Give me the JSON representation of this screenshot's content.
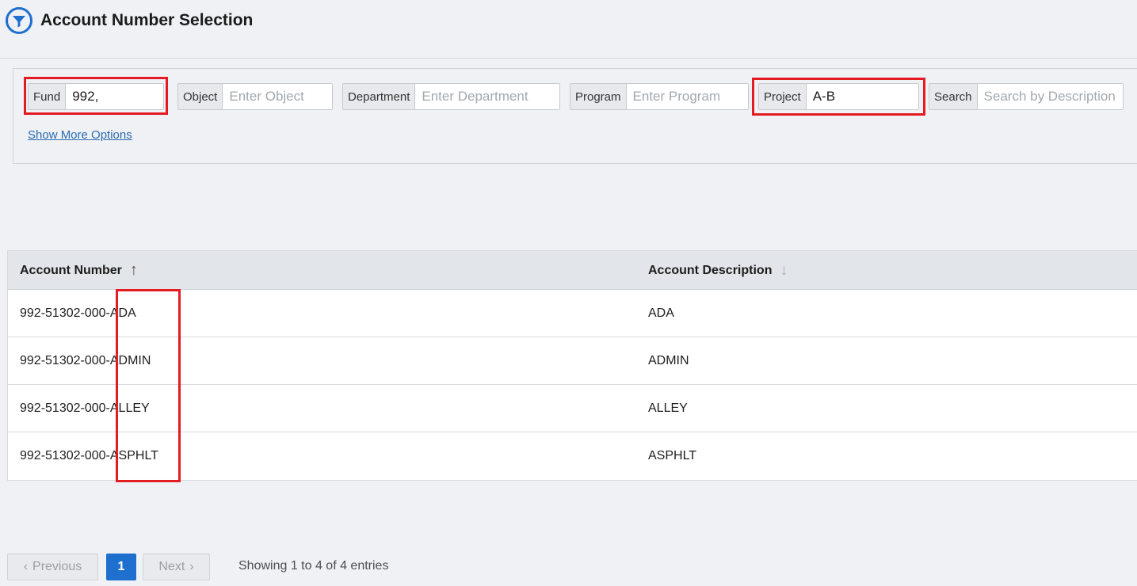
{
  "header": {
    "title": "Account Number Selection",
    "icon": "filter-funnel-icon",
    "icon_color": "#1f6fcf"
  },
  "filters": {
    "fund": {
      "label": "Fund",
      "value": "992,",
      "placeholder": ""
    },
    "object": {
      "label": "Object",
      "value": "",
      "placeholder": "Enter Object"
    },
    "department": {
      "label": "Department",
      "value": "",
      "placeholder": "Enter Department"
    },
    "program": {
      "label": "Program",
      "value": "",
      "placeholder": "Enter Program"
    },
    "project": {
      "label": "Project",
      "value": "A-B",
      "placeholder": ""
    },
    "search": {
      "label": "Search",
      "value": "",
      "placeholder": "Search by Description"
    },
    "show_more": "Show More Options"
  },
  "table": {
    "columns": [
      {
        "label": "Account Number",
        "sort_icon": "↑",
        "sort": "ascending"
      },
      {
        "label": "Account Description",
        "sort_icon": "↓",
        "sort": "none"
      }
    ],
    "rows": [
      {
        "account_number": "992-51302-000-ADA",
        "description": "ADA"
      },
      {
        "account_number": "992-51302-000-ADMIN",
        "description": "ADMIN"
      },
      {
        "account_number": "992-51302-000-ALLEY",
        "description": "ALLEY"
      },
      {
        "account_number": "992-51302-000-ASPHLT",
        "description": "ASPHLT"
      }
    ]
  },
  "pagination": {
    "previous": "Previous",
    "next": "Next",
    "current_page": "1",
    "prev_icon": "‹",
    "next_icon": "›",
    "summary": "Showing 1 to 4 of 4 entries"
  },
  "colors": {
    "highlight": "#e31b23",
    "accent": "#1f6fcf",
    "link": "#2a6bb0"
  }
}
